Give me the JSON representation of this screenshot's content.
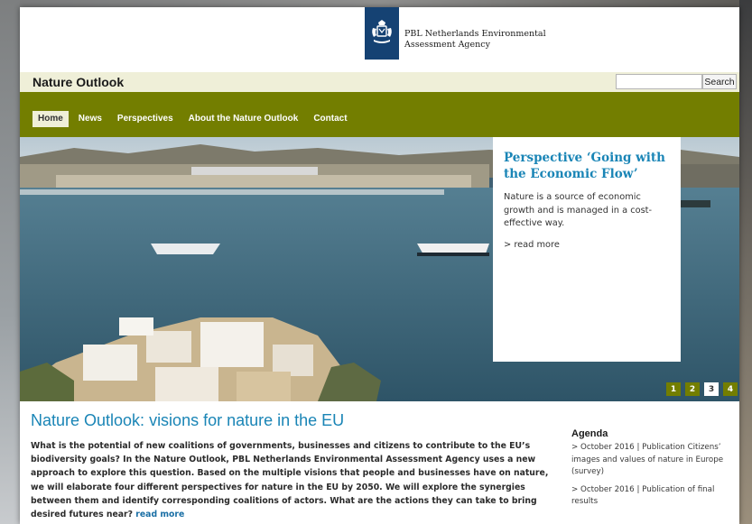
{
  "brand": {
    "org_line1": "PBL Netherlands Environmental",
    "org_line2": "Assessment Agency",
    "logo_icon": "coat-of-arms-icon",
    "brand_blue": "#154273"
  },
  "site": {
    "title": "Nature Outlook",
    "accent_green": "#737e00",
    "accent_blue": "#1a85b6"
  },
  "search": {
    "value": "",
    "placeholder": "",
    "button_label": "Search"
  },
  "nav": {
    "items": [
      {
        "label": "Home",
        "active": true
      },
      {
        "label": "News",
        "active": false
      },
      {
        "label": "Perspectives",
        "active": false
      },
      {
        "label": "About the Nature Outlook",
        "active": false
      },
      {
        "label": "Contact",
        "active": false
      }
    ]
  },
  "hero": {
    "promo_title": "Perspective ‘Going with the Economic Flow’",
    "promo_body": "Nature is a source of economic growth and is managed in a cost-effective way.",
    "promo_link": "> read more",
    "pager": [
      "1",
      "2",
      "3",
      "4"
    ],
    "active_page": "3"
  },
  "main": {
    "headline": "Nature Outlook: visions for nature in the EU",
    "intro": "What is the potential of new coalitions of governments, businesses and citizens to contribute to the EU’s biodiversity goals? In the Nature Outlook, PBL Netherlands Environmental Assessment Agency uses a new approach to explore this question. Based on the multiple visions that people and businesses have on nature, we will elaborate four different perspectives for nature in the EU by 2050. We will explore the synergies between them and identify corresponding coalitions of actors. What are the actions they can take to bring desired futures near?",
    "intro_link": "read more"
  },
  "agenda": {
    "title": "Agenda",
    "items": [
      "> October 2016 | Publication Citizens’ images and values of nature in Europe (survey)",
      "> October 2016 | Publication of final results"
    ]
  }
}
